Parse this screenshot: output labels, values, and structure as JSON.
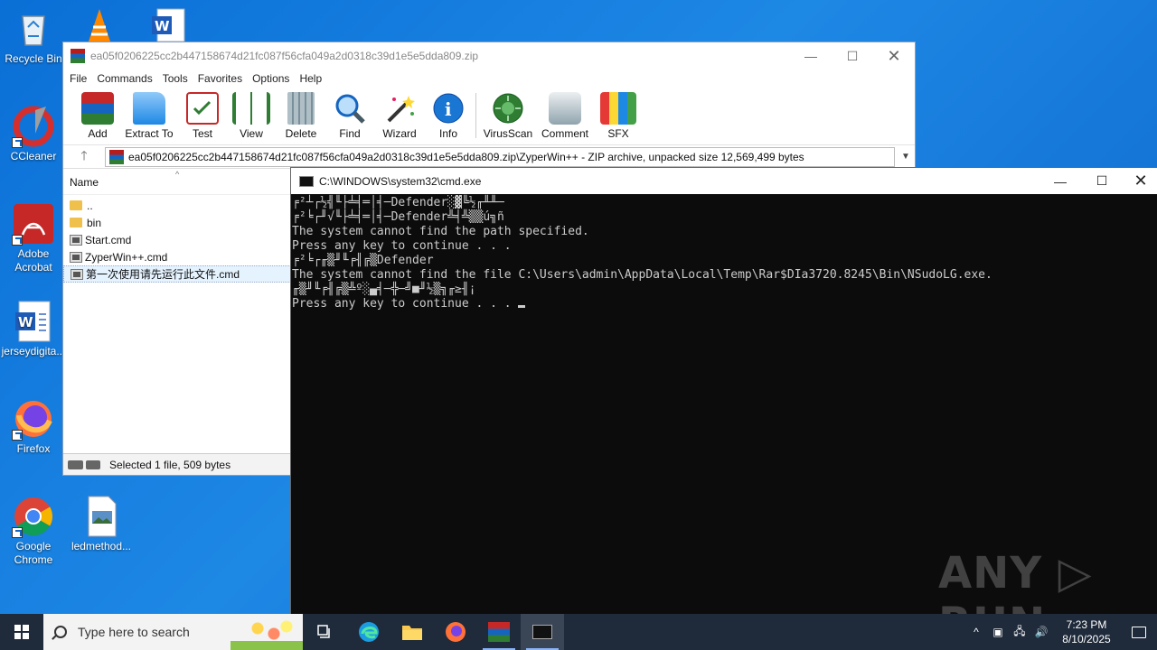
{
  "desktop": {
    "icons": [
      {
        "label": "Recycle Bin"
      },
      {
        "label": "CCleaner"
      },
      {
        "label": "Adobe Acrobat"
      },
      {
        "label": "jerseydigita..."
      },
      {
        "label": "Firefox"
      },
      {
        "label": "Google Chrome"
      },
      {
        "label": "ledmethod..."
      }
    ]
  },
  "winrar": {
    "title": "ea05f0206225cc2b447158674d21fc087f56cfa049a2d0318c39d1e5e5dda809.zip",
    "menu": [
      "File",
      "Commands",
      "Tools",
      "Favorites",
      "Options",
      "Help"
    ],
    "toolbar": [
      "Add",
      "Extract To",
      "Test",
      "View",
      "Delete",
      "Find",
      "Wizard",
      "Info",
      "VirusScan",
      "Comment",
      "SFX"
    ],
    "address": "ea05f0206225cc2b447158674d21fc087f56cfa049a2d0318c39d1e5e5dda809.zip\\ZyperWin++ - ZIP archive, unpacked size 12,569,499 bytes",
    "column_name": "Name",
    "files": [
      "..",
      "bin",
      "Start.cmd",
      "ZyperWin++.cmd",
      "第一次使用请先运行此文件.cmd"
    ],
    "status": "Selected 1 file, 509 bytes"
  },
  "cmd": {
    "title": "C:\\WINDOWS\\system32\\cmd.exe",
    "lines": [
      "╒²┴┌½╣╙├╧╡═│╡─Defender░▓╚½╓╨╨─",
      "╒²╘┌╜√╙├╧╡═│╡─Defender╩╡╩▒▒ú╗ñ",
      "The system cannot find the path specified.",
      "Press any key to continue . . .",
      "╒²╘┌╓▒╜╙╒╢╔▒Defender",
      "The system cannot find the file C:\\Users\\admin\\AppData\\Local\\Temp\\Rar$DIa3720.8245\\Bin\\NSudoLG.exe.",
      "╓▒╜╙╒╢╔▒╩º░▄╡─╬─╝■╜½▒╗╓≥╢¡",
      "Press any key to continue . . . "
    ]
  },
  "taskbar": {
    "search_placeholder": "Type here to search",
    "time": "7:23 PM",
    "date": "8/10/2025"
  },
  "watermark": "ANY ▷ RUN",
  "colors": {
    "desktop": "#1e88e5",
    "taskbar": "#1f2a3a",
    "console_bg": "#0c0c0c",
    "console_fg": "#cccccc"
  }
}
